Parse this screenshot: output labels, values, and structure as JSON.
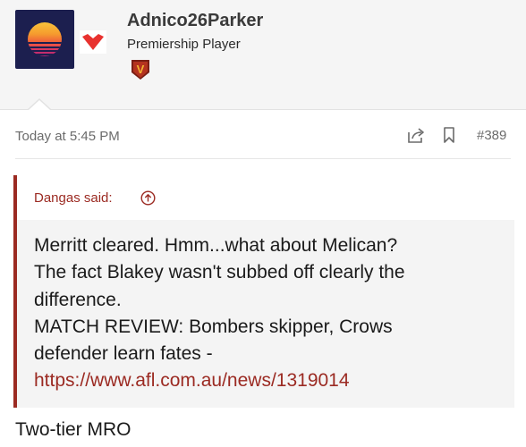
{
  "user": {
    "name": "Adnico26Parker",
    "title": "Premiership Player",
    "badge_letter": "V",
    "heart_color": "#e8322f",
    "avatar_bg": "#1c1f4f"
  },
  "post": {
    "timestamp": "Today at 5:45 PM",
    "number": "#389",
    "icons": [
      "share-icon",
      "bookmark-icon"
    ]
  },
  "quote": {
    "attribution": "Dangas said:",
    "lines": [
      "Merritt cleared. Hmm...what about Melican?",
      "The fact Blakey wasn't subbed off clearly the",
      "difference.",
      "MATCH REVIEW: Bombers skipper, Crows",
      "defender learn fates -"
    ],
    "link": "https://www.afl.com.au/news/1319014",
    "accent_color": "#9b2a22"
  },
  "message": {
    "text": "Two-tier MRO"
  }
}
